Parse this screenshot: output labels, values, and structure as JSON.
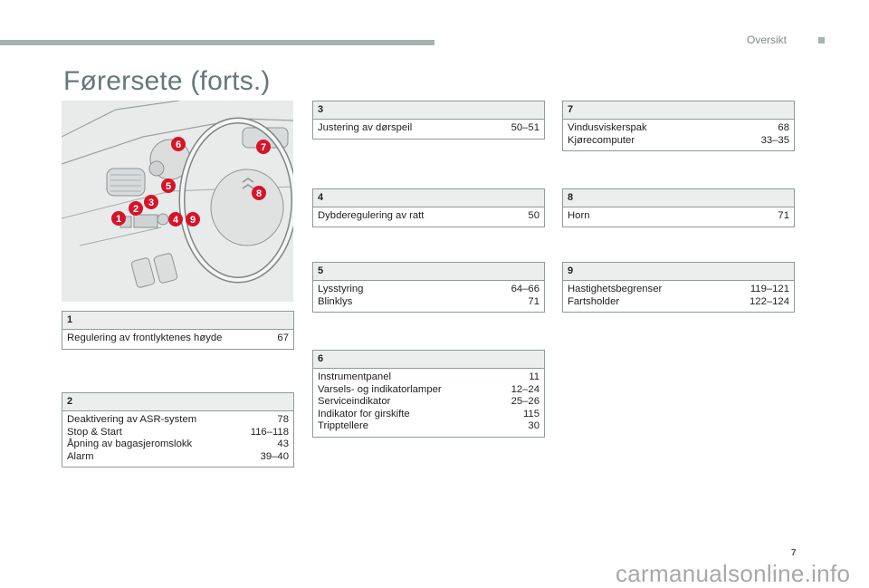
{
  "header": {
    "section_label": "Oversikt",
    "page_title": "Førersete (forts.)"
  },
  "illustration": {
    "description": "Dashboard and steering wheel line drawing with numbered callouts",
    "callouts": [
      "1",
      "2",
      "3",
      "4",
      "5",
      "6",
      "7",
      "8",
      "9"
    ],
    "callout_color": "#d5142a"
  },
  "boxes": [
    {
      "number": "1",
      "items": [
        {
          "label": "Regulering av frontlyktenes høyde",
          "pages": "67"
        }
      ]
    },
    {
      "number": "2",
      "items": [
        {
          "label": "Deaktivering av ASR-system",
          "pages": "78"
        },
        {
          "label": "Stop & Start",
          "pages": "116–118"
        },
        {
          "label": "Åpning av bagasjeromslokk",
          "pages": "43"
        },
        {
          "label": "Alarm",
          "pages": "39–40"
        }
      ]
    },
    {
      "number": "3",
      "items": [
        {
          "label": "Justering av dørspeil",
          "pages": "50–51"
        }
      ]
    },
    {
      "number": "4",
      "items": [
        {
          "label": "Dybderegulering av ratt",
          "pages": "50"
        }
      ]
    },
    {
      "number": "5",
      "items": [
        {
          "label": "Lysstyring",
          "pages": "64–66"
        },
        {
          "label": "Blinklys",
          "pages": "71"
        }
      ]
    },
    {
      "number": "6",
      "items": [
        {
          "label": "Instrumentpanel",
          "pages": "11"
        },
        {
          "label": "Varsels- og indikatorlamper",
          "pages": "12–24"
        },
        {
          "label": "Serviceindikator",
          "pages": "25–26"
        },
        {
          "label": "Indikator for girskifte",
          "pages": "115"
        },
        {
          "label": "Tripptellere",
          "pages": "30"
        }
      ]
    },
    {
      "number": "7",
      "items": [
        {
          "label": "Vindusviskerspak",
          "pages": "68"
        },
        {
          "label": "Kjørecomputer",
          "pages": "33–35"
        }
      ]
    },
    {
      "number": "8",
      "items": [
        {
          "label": "Horn",
          "pages": "71"
        }
      ]
    },
    {
      "number": "9",
      "items": [
        {
          "label": "Hastighetsbegrenser",
          "pages": "119–121"
        },
        {
          "label": "Fartsholder",
          "pages": "122–124"
        }
      ]
    }
  ],
  "footer": {
    "page_number": "7",
    "watermark": "carmanualsonline.info"
  }
}
